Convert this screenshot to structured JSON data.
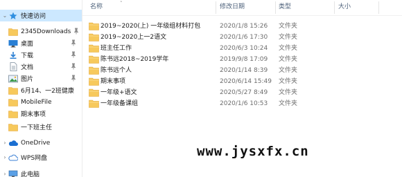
{
  "sidebar": {
    "items": [
      {
        "label": "快速访问",
        "icon": "star-icon",
        "pinned": false,
        "selected": true
      },
      {
        "label": "2345Downloads",
        "icon": "folder-icon",
        "pinned": true
      },
      {
        "label": "桌面",
        "icon": "desktop-icon",
        "pinned": true
      },
      {
        "label": "下载",
        "icon": "download-icon",
        "pinned": true
      },
      {
        "label": "文档",
        "icon": "document-icon",
        "pinned": true
      },
      {
        "label": "图片",
        "icon": "picture-icon",
        "pinned": true
      },
      {
        "label": "6月14、一2班健康",
        "icon": "folder-icon",
        "pinned": false
      },
      {
        "label": "MobileFile",
        "icon": "folder-icon",
        "pinned": false
      },
      {
        "label": "期末事项",
        "icon": "folder-icon",
        "pinned": false
      },
      {
        "label": "一下班主任",
        "icon": "folder-icon",
        "pinned": false
      },
      {
        "label": "OneDrive",
        "icon": "cloud-icon",
        "pinned": false
      },
      {
        "label": "WPS网盘",
        "icon": "wps-cloud-icon",
        "pinned": false
      },
      {
        "label": "此电脑",
        "icon": "computer-icon",
        "pinned": false
      }
    ]
  },
  "columns": {
    "name": "名称",
    "date": "修改日期",
    "type": "类型",
    "size": "大小"
  },
  "files": [
    {
      "name": "2019~2020(上) 一年级组材料打包",
      "date": "2020/1/8 15:26",
      "type": "文件夹"
    },
    {
      "name": "2019~2020上一2语文",
      "date": "2020/1/6 17:30",
      "type": "文件夹"
    },
    {
      "name": "班主任工作",
      "date": "2020/6/3 10:24",
      "type": "文件夹"
    },
    {
      "name": "陈书远2018~2019学年",
      "date": "2019/9/8 17:09",
      "type": "文件夹"
    },
    {
      "name": "陈书远个人",
      "date": "2020/1/14 8:39",
      "type": "文件夹"
    },
    {
      "name": "期末事项",
      "date": "2020/6/14 15:49",
      "type": "文件夹"
    },
    {
      "name": "一年级+语文",
      "date": "2020/5/27 8:49",
      "type": "文件夹"
    },
    {
      "name": "一年级备课组",
      "date": "2020/1/6 10:53",
      "type": "文件夹"
    }
  ],
  "watermark": {
    "text": "www.jysxfx.cn"
  },
  "colors": {
    "folder": "#f7c95c",
    "folder_dark": "#e4a93a",
    "selection": "#cce8ff",
    "header_text": "#4c607a"
  }
}
